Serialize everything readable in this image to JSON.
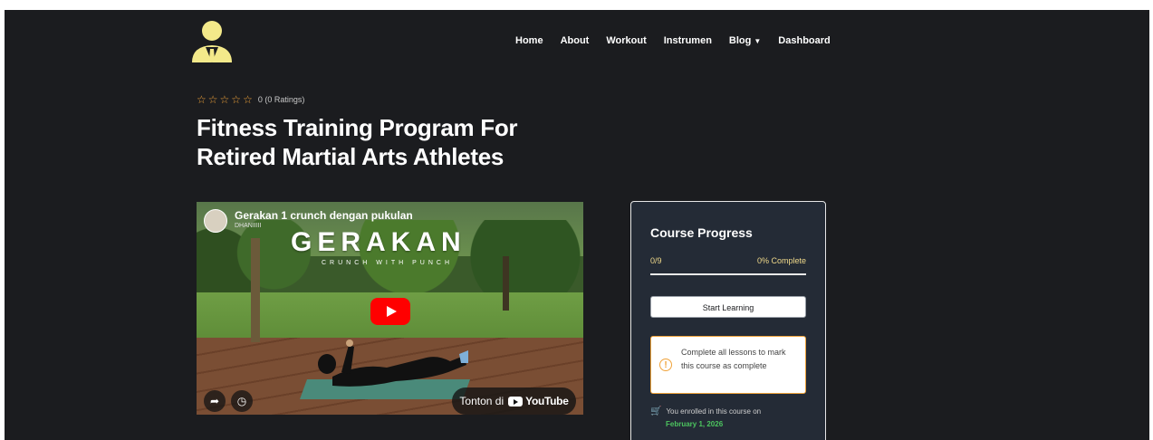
{
  "header": {
    "logo_icon": "businessman-avatar-icon",
    "nav": [
      {
        "label": "Home"
      },
      {
        "label": "About"
      },
      {
        "label": "Workout"
      },
      {
        "label": "Instrumen"
      },
      {
        "label": "Blog",
        "has_dropdown": true
      },
      {
        "label": "Dashboard"
      }
    ]
  },
  "course": {
    "rating_stars": 0,
    "rating_max": 5,
    "rating_text": "0 (0 Ratings)",
    "title": "Fitness Training Program For Retired Martial Arts Athletes"
  },
  "video": {
    "video_title": "Gerakan 1 crunch dengan pukulan",
    "channel": "DHANIIIII",
    "overlay_title": "GERAKAN",
    "overlay_subtitle": "CRUNCH WITH PUNCH",
    "watch_on_label": "Tonton di",
    "platform_label": "YouTube"
  },
  "progress": {
    "title": "Course Progress",
    "count": "0/9",
    "percent_label": "0% Complete",
    "percent": 0,
    "start_button": "Start Learning",
    "notice": "Complete all lessons to mark this course as complete",
    "enrolled_text": "You enrolled in this course on",
    "enrolled_date": "February 1, 2026"
  },
  "colors": {
    "background": "#1b1c1f",
    "panel": "#242b36",
    "accent_orange": "#f0a33a",
    "accent_green": "#4cc45f",
    "logo_yellow": "#f3e98a"
  }
}
